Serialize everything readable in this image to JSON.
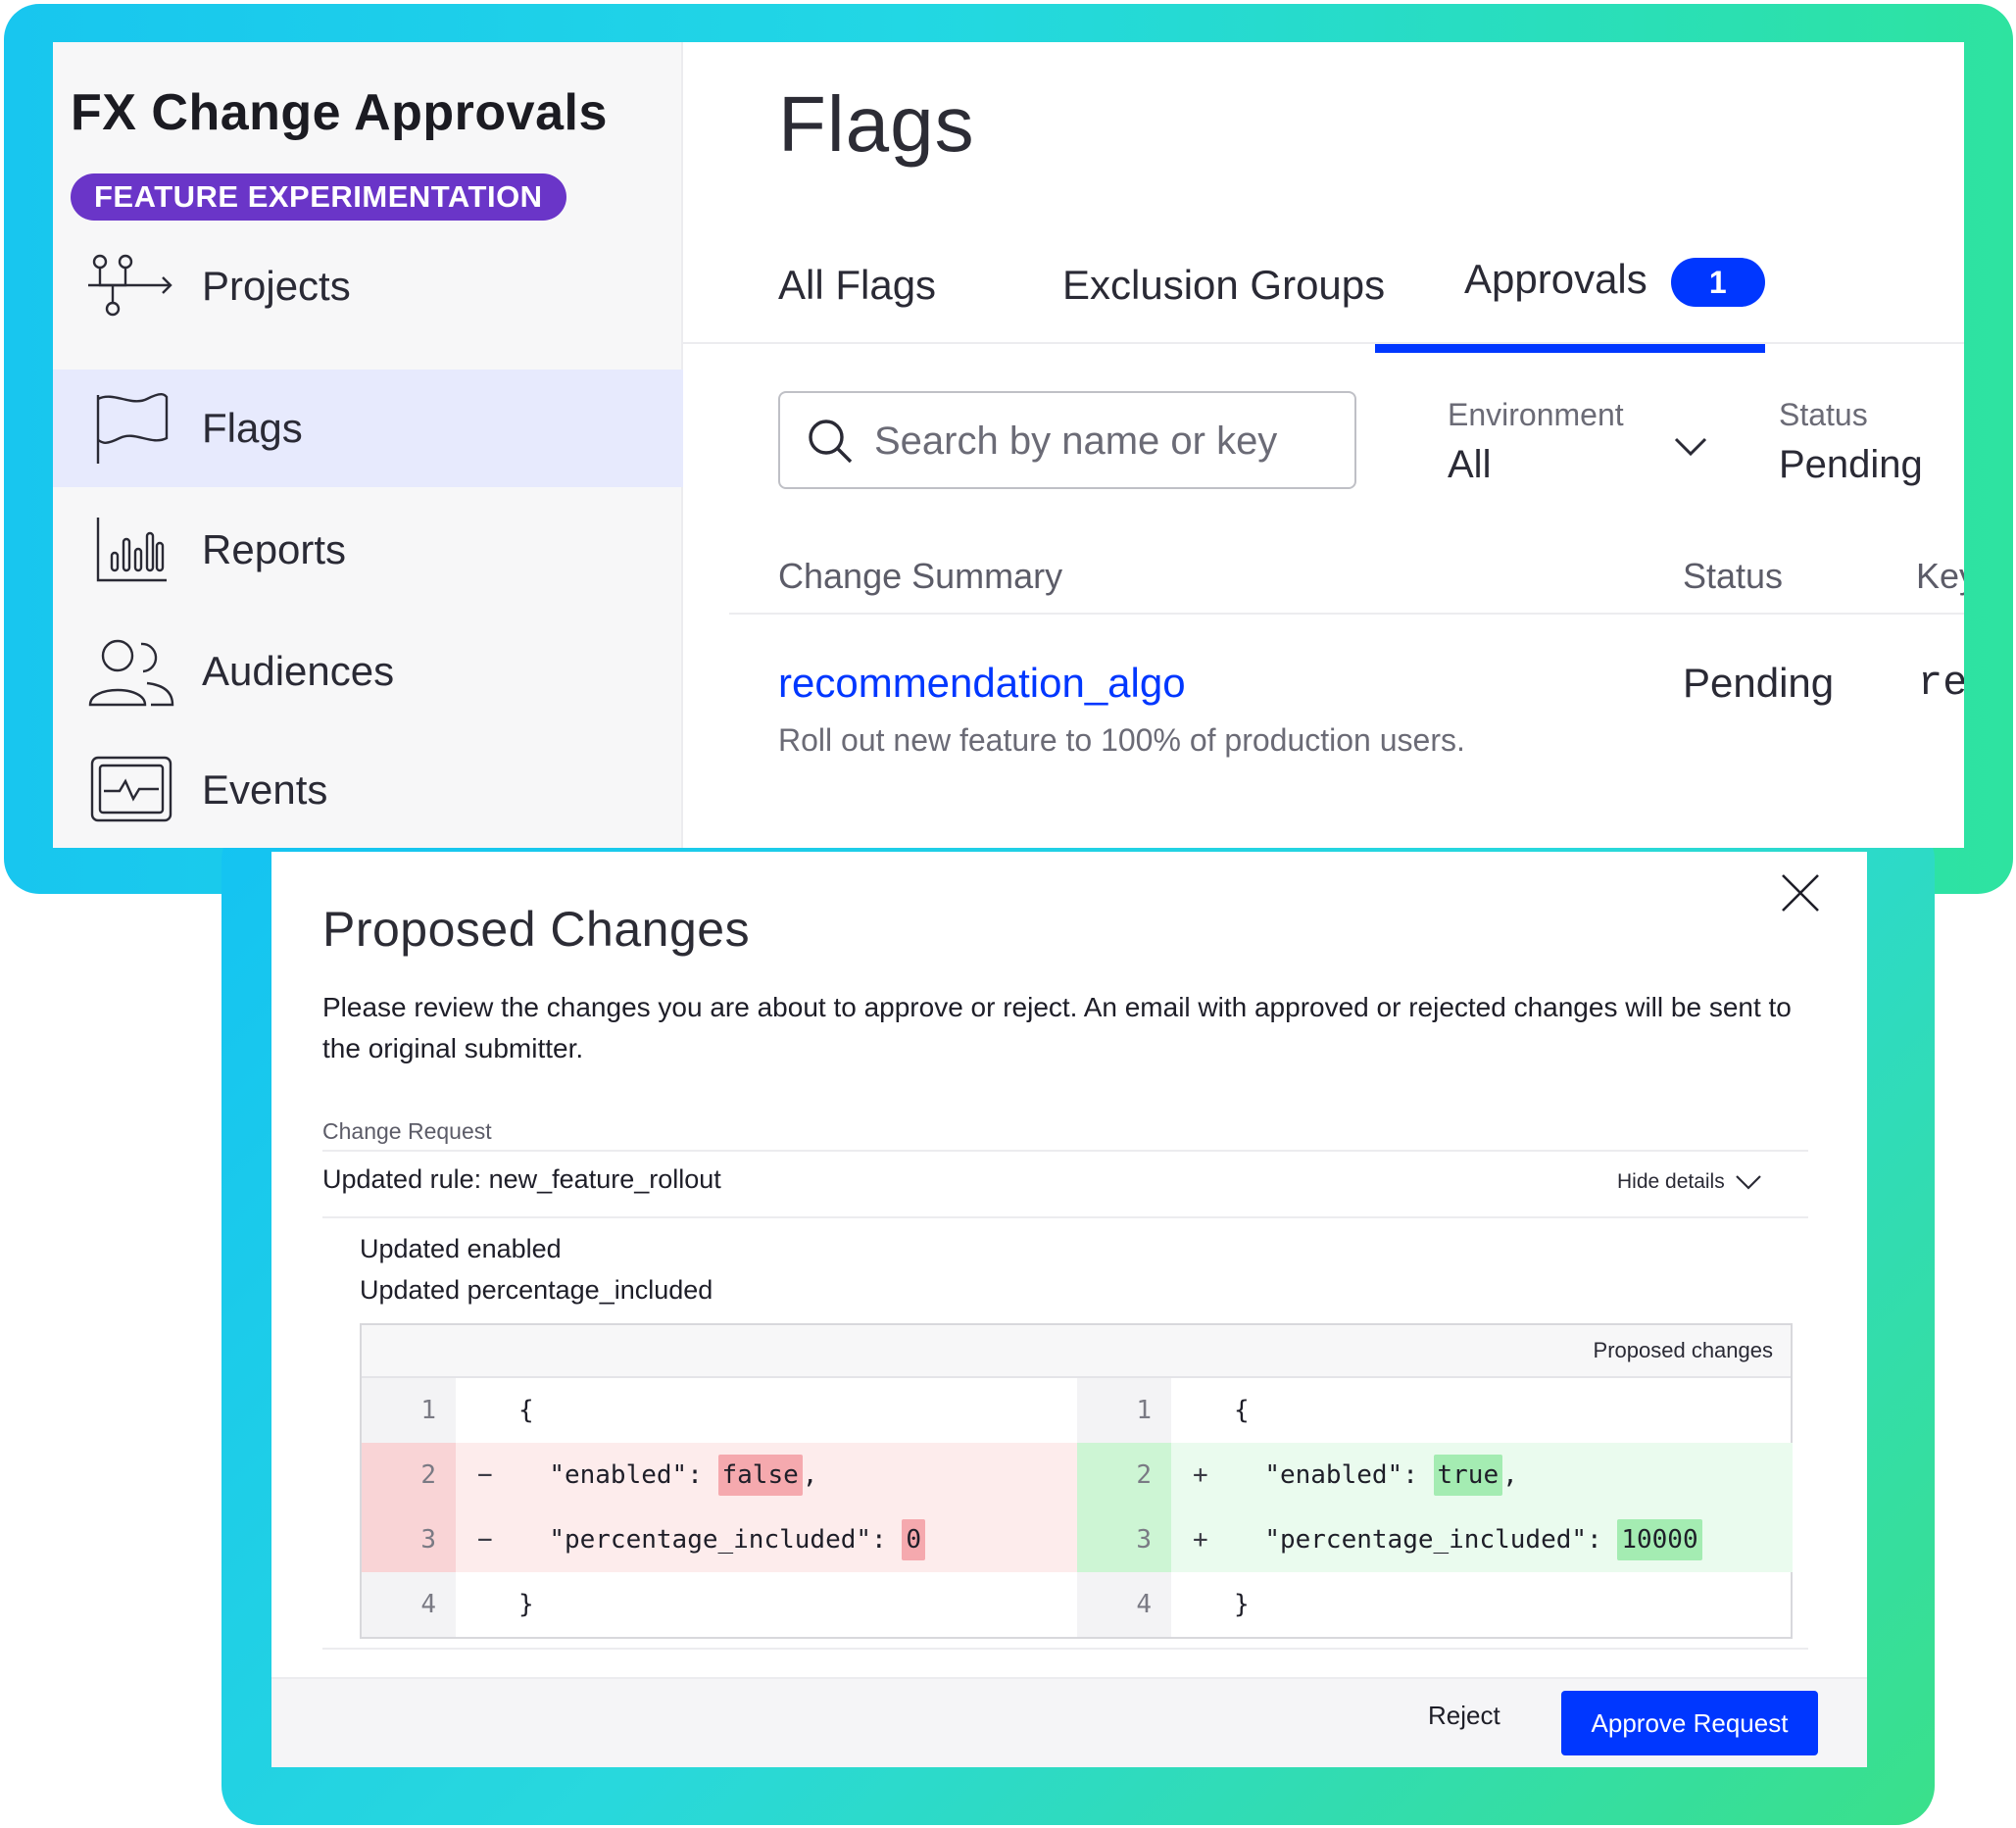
{
  "app": {
    "title": "FX Change Approvals",
    "badge": "FEATURE EXPERIMENTATION"
  },
  "sidebar": {
    "items": [
      {
        "label": "Projects",
        "icon": "projects-flow-icon",
        "active": false
      },
      {
        "label": "Flags",
        "icon": "flag-icon",
        "active": true
      },
      {
        "label": "Reports",
        "icon": "bar-chart-icon",
        "active": false
      },
      {
        "label": "Audiences",
        "icon": "users-icon",
        "active": false
      },
      {
        "label": "Events",
        "icon": "activity-monitor-icon",
        "active": false
      }
    ]
  },
  "main": {
    "title": "Flags",
    "tabs": [
      {
        "label": "All Flags"
      },
      {
        "label": "Exclusion Groups"
      },
      {
        "label": "Approvals",
        "badge": "1",
        "active": true
      }
    ],
    "search": {
      "placeholder": "Search by name or key"
    },
    "filters": {
      "environment": {
        "label": "Environment",
        "value": "All"
      },
      "status": {
        "label": "Status",
        "value": "Pending"
      }
    },
    "table": {
      "headers": {
        "summary": "Change Summary",
        "status": "Status",
        "key": "Key"
      },
      "rows": [
        {
          "name": "recommendation_algo",
          "description": "Roll out new feature to 100% of production users.",
          "status": "Pending",
          "key": "reco"
        }
      ]
    }
  },
  "modal": {
    "title": "Proposed Changes",
    "description": "Please review the changes you are about to approve or reject. An email with approved or rejected changes will be sent to the original submitter.",
    "change_request_label": "Change Request",
    "rule_title": "Updated rule: new_feature_rollout",
    "hide_details": "Hide details",
    "updates": [
      "Updated enabled",
      "Updated percentage_included"
    ],
    "diff": {
      "header": "Proposed changes",
      "left": [
        {
          "num": "1",
          "mark": "",
          "pre": "{",
          "value": "",
          "post": ""
        },
        {
          "num": "2",
          "mark": "−",
          "pre": "\"enabled\": ",
          "value": "false",
          "post": ","
        },
        {
          "num": "3",
          "mark": "−",
          "pre": "\"percentage_included\": ",
          "value": "0",
          "post": ""
        },
        {
          "num": "4",
          "mark": "",
          "pre": "}",
          "value": "",
          "post": ""
        }
      ],
      "right": [
        {
          "num": "1",
          "mark": "",
          "pre": "{",
          "value": "",
          "post": ""
        },
        {
          "num": "2",
          "mark": "+",
          "pre": "\"enabled\": ",
          "value": "true",
          "post": ","
        },
        {
          "num": "3",
          "mark": "+",
          "pre": "\"percentage_included\": ",
          "value": "10000",
          "post": ""
        },
        {
          "num": "4",
          "mark": "",
          "pre": "}",
          "value": "",
          "post": ""
        }
      ]
    },
    "buttons": {
      "reject": "Reject",
      "approve": "Approve Request"
    }
  },
  "colors": {
    "accent": "#0037ff",
    "badge_purple": "#6a35c8",
    "removed_bg": "#fdecec",
    "added_bg": "#eafbee",
    "frame_gradient_start": "#18c6ef",
    "frame_gradient_end": "#3ae08a"
  }
}
